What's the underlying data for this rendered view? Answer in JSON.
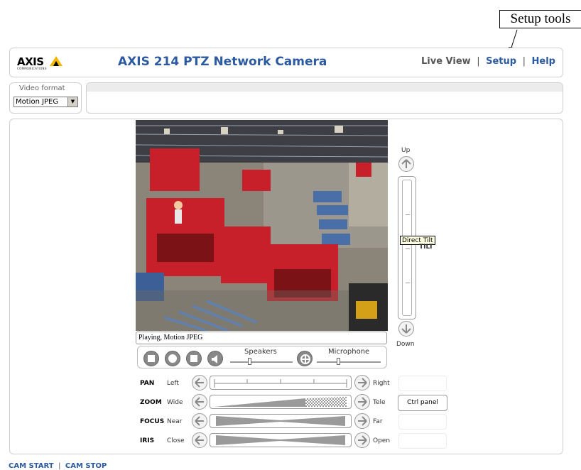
{
  "annotation": {
    "label": "Setup tools"
  },
  "header": {
    "logo_text": "AXIS",
    "logo_sub": "COMMUNICATIONS",
    "title": "AXIS 214 PTZ Network Camera",
    "nav": {
      "live_view": "Live View",
      "setup": "Setup",
      "help": "Help",
      "separator": "|"
    }
  },
  "video_format": {
    "label": "Video format",
    "selected": "Motion JPEG"
  },
  "player": {
    "status": "Playing, Motion JPEG",
    "speakers_label": "Speakers",
    "microphone_label": "Microphone"
  },
  "tilt": {
    "up_label": "Up",
    "down_label": "Down",
    "tooltip": "Direct Tilt",
    "label": "TILT"
  },
  "ptz": {
    "pan": {
      "label": "PAN",
      "left": "Left",
      "right": "Right"
    },
    "zoom": {
      "label": "ZOOM",
      "left": "Wide",
      "right": "Tele"
    },
    "focus": {
      "label": "FOCUS",
      "left": "Near",
      "right": "Far"
    },
    "iris": {
      "label": "IRIS",
      "left": "Close",
      "right": "Open"
    },
    "ctrl_panel_label": "Ctrl panel"
  },
  "footer": {
    "cam_start": "CAM START",
    "cam_stop": "CAM STOP",
    "separator": "|"
  },
  "colors": {
    "brand_blue": "#2c5aa0",
    "logo_yellow": "#f5b800",
    "machine_red": "#c8202a"
  }
}
